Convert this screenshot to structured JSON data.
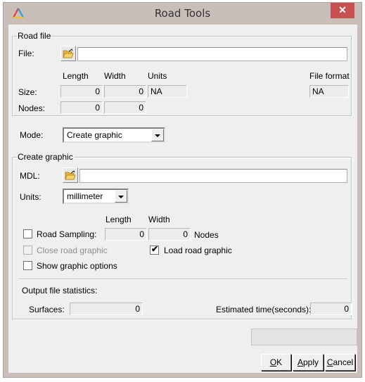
{
  "window": {
    "title": "Road Tools",
    "close_icon": "close-icon",
    "app_icon": "app-logo-icon"
  },
  "road_file": {
    "group_label": "Road file",
    "file_label": "File:",
    "file_value": "",
    "browse_icon": "folder-open-icon",
    "col_length": "Length",
    "col_width": "Width",
    "col_units": "Units",
    "col_file_format": "File format",
    "size_label": "Size:",
    "size_length": "0",
    "size_width": "0",
    "size_units": "NA",
    "file_format": "NA",
    "nodes_label": "Nodes:",
    "nodes_length": "0",
    "nodes_width": "0"
  },
  "mode": {
    "label": "Mode:",
    "selected": "Create graphic"
  },
  "create_graphic": {
    "group_label": "Create graphic",
    "mdl_label": "MDL:",
    "mdl_value": "",
    "units_label": "Units:",
    "units_selected": "millimeter",
    "col_length": "Length",
    "col_width": "Width",
    "road_sampling_label": "Road Sampling:",
    "road_sampling_checked": false,
    "sampling_length": "0",
    "sampling_width": "0",
    "nodes_suffix": "Nodes",
    "close_road_graphic_label": "Close road graphic",
    "close_road_graphic_checked": false,
    "load_road_graphic_label": "Load road graphic",
    "load_road_graphic_checked": true,
    "show_graphic_options_label": "Show graphic options",
    "show_graphic_options_checked": false,
    "output_stats_label": "Output file statistics:",
    "surfaces_label": "Surfaces:",
    "surfaces_value": "0",
    "estimated_time_label": "Estimated time(seconds):",
    "estimated_time_value": "0"
  },
  "buttons": {
    "ok_mnemonic": "O",
    "ok_rest": "K",
    "apply_mnemonic": "A",
    "apply_rest": "pply",
    "cancel_mnemonic": "C",
    "cancel_rest": "ancel"
  }
}
